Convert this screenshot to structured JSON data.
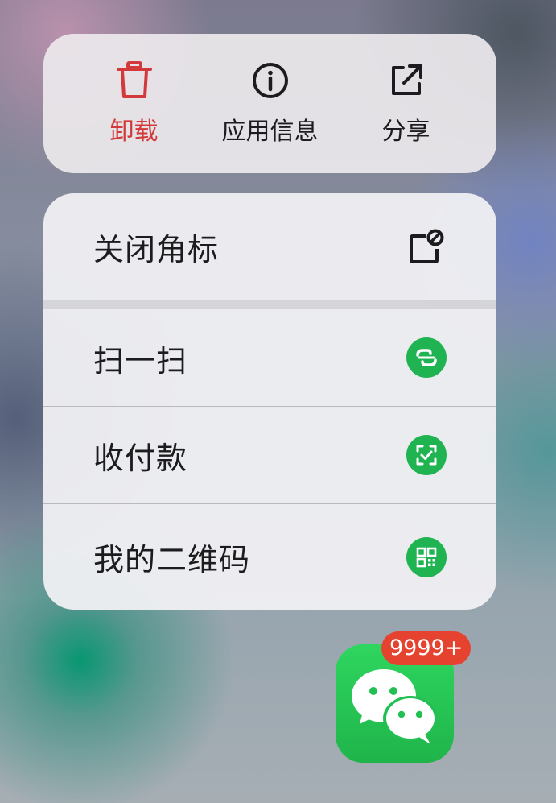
{
  "quick_actions": [
    {
      "label": "卸载",
      "icon": "trash-icon",
      "color": "#d3393a"
    },
    {
      "label": "应用信息",
      "icon": "info-icon",
      "color": "#1c1c1e"
    },
    {
      "label": "分享",
      "icon": "share-icon",
      "color": "#1c1c1e"
    }
  ],
  "menu": {
    "items": [
      {
        "label": "关闭角标",
        "icon": "hide-badge-icon"
      },
      {
        "label": "扫一扫",
        "icon": "scan-icon"
      },
      {
        "label": "收付款",
        "icon": "payment-icon"
      },
      {
        "label": "我的二维码",
        "icon": "qr-code-icon"
      }
    ]
  },
  "app": {
    "icon": "wechat-icon",
    "badge": "9999+",
    "brand_color": "#1fb351",
    "badge_color": "#e5432f"
  }
}
